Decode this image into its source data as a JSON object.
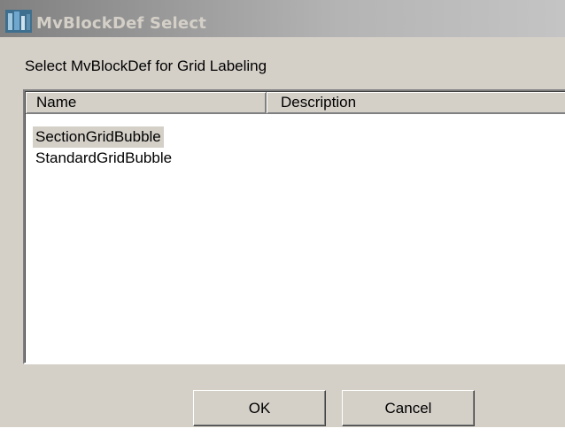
{
  "window": {
    "title": "MvBlockDef Select",
    "icon": "app-icon"
  },
  "prompt": "Select MvBlockDef for Grid Labeling",
  "list": {
    "columns": [
      "Name",
      "Description"
    ],
    "rows": [
      {
        "name": "SectionGridBubble",
        "description": "",
        "selected": true
      },
      {
        "name": "StandardGridBubble",
        "description": "",
        "selected": false
      }
    ]
  },
  "buttons": {
    "ok": "OK",
    "cancel": "Cancel"
  },
  "colors": {
    "dialog_face": "#d4d0c8",
    "title_gradient_start": "#808080",
    "title_gradient_end": "#c4c4c4"
  }
}
